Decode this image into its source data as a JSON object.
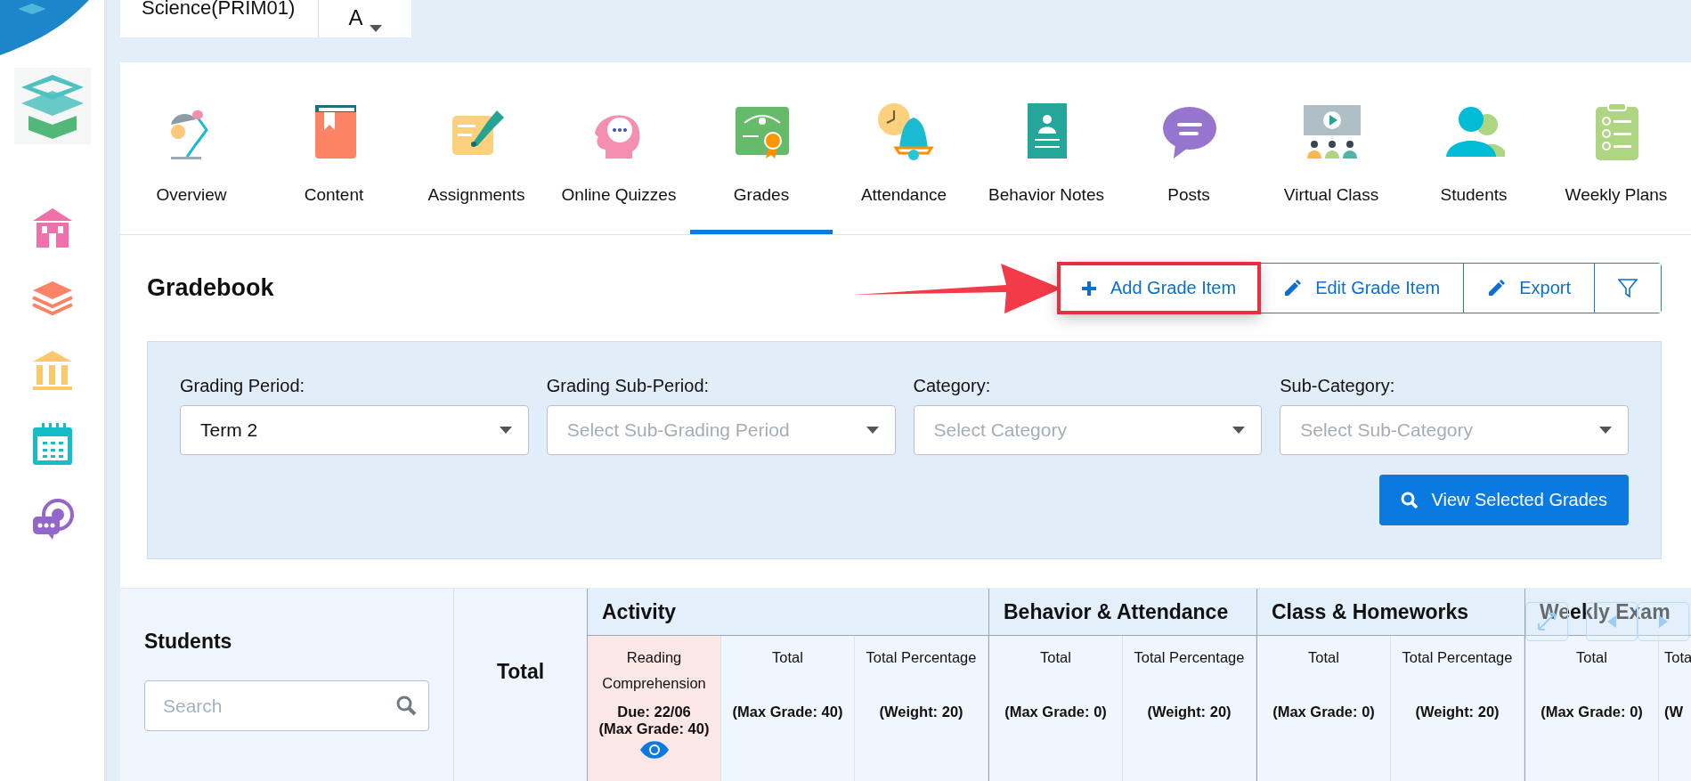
{
  "header": {
    "course": "Science(PRIM01)",
    "section": "A"
  },
  "tabs": [
    {
      "label": "Overview",
      "selected": false
    },
    {
      "label": "Content",
      "selected": false
    },
    {
      "label": "Assignments",
      "selected": false
    },
    {
      "label": "Online Quizzes",
      "selected": false
    },
    {
      "label": "Grades",
      "selected": true
    },
    {
      "label": "Attendance",
      "selected": false
    },
    {
      "label": "Behavior Notes",
      "selected": false
    },
    {
      "label": "Posts",
      "selected": false
    },
    {
      "label": "Virtual Class",
      "selected": false
    },
    {
      "label": "Students",
      "selected": false
    },
    {
      "label": "Weekly Plans",
      "selected": false
    }
  ],
  "gradebook": {
    "title": "Gradebook",
    "actions": [
      {
        "kind": "add",
        "label": "Add Grade Item",
        "highlighted": true
      },
      {
        "kind": "edit",
        "label": "Edit Grade Item",
        "highlighted": false
      },
      {
        "kind": "export",
        "label": "Export",
        "highlighted": false
      },
      {
        "kind": "filter",
        "highlighted": false
      }
    ]
  },
  "filters": [
    {
      "label": "Grading Period:",
      "value": "Term 2"
    },
    {
      "label": "Grading Sub-Period:",
      "placeholder": "Select Sub-Grading Period"
    },
    {
      "label": "Category:",
      "placeholder": "Select Category"
    },
    {
      "label": "Sub-Category:",
      "placeholder": "Select Sub-Category"
    }
  ],
  "view_button": "View Selected Grades",
  "table": {
    "students_heading": "Students",
    "search_placeholder": "Search",
    "total_heading": "Total",
    "groups": [
      {
        "title": "Activity",
        "columns": [
          {
            "kind": "item",
            "title": "Reading Comprehension",
            "due": "Due: 22/06",
            "info": "(Max Grade: 40)"
          },
          {
            "kind": "summary",
            "title": "Total",
            "info": "(Max Grade: 40)"
          },
          {
            "kind": "summary",
            "title": "Total Percentage",
            "info": "(Weight: 20)"
          }
        ]
      },
      {
        "title": "Behavior & Attendance",
        "columns": [
          {
            "kind": "summary",
            "title": "Total",
            "info": "(Max Grade: 0)"
          },
          {
            "kind": "summary",
            "title": "Total Percentage",
            "info": "(Weight: 20)"
          }
        ]
      },
      {
        "title": "Class & Homeworks",
        "columns": [
          {
            "kind": "summary",
            "title": "Total",
            "info": "(Max Grade: 0)"
          },
          {
            "kind": "summary",
            "title": "Total Percentage",
            "info": "(Weight: 20)"
          }
        ]
      },
      {
        "title": "Weekly Exam",
        "columns": [
          {
            "kind": "summary",
            "title": "Total",
            "info": "(Max Grade: 0)"
          },
          {
            "kind": "clipped",
            "title": "Tota",
            "info": "(W"
          }
        ]
      }
    ]
  }
}
